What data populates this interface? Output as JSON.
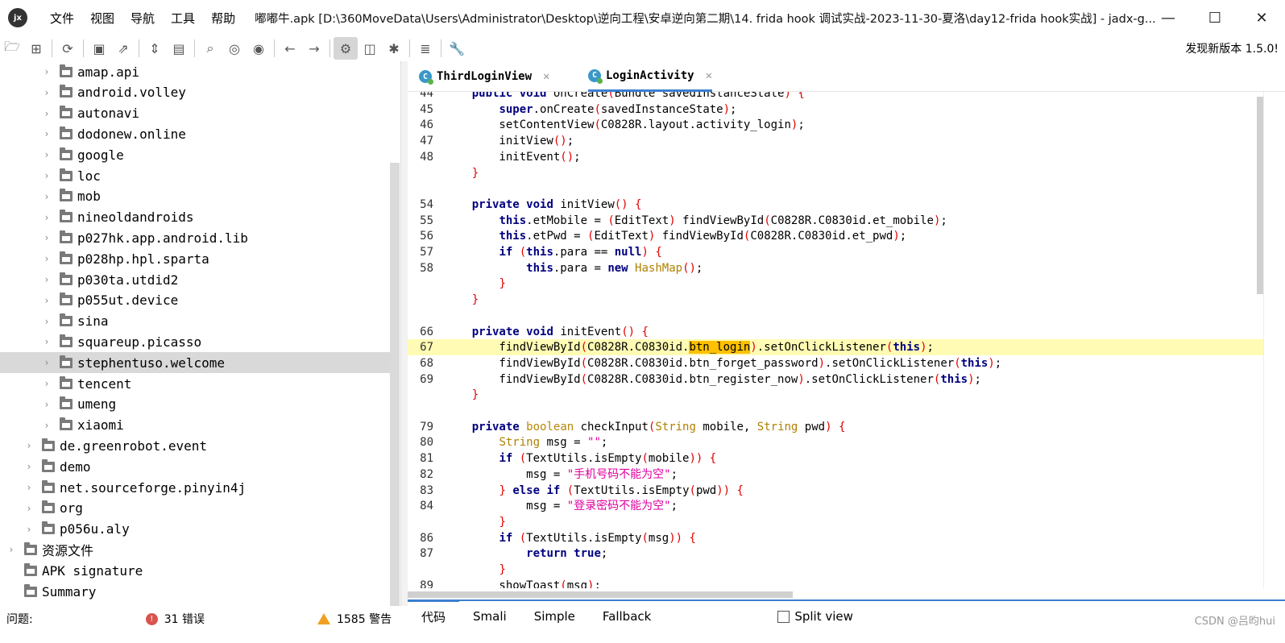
{
  "window": {
    "app_logo": "jadx-logo-icon",
    "title": "嘟嘟牛.apk [D:\\360MoveData\\Users\\Administrator\\Desktop\\逆向工程\\安卓逆向第二期\\14. frida hook 调试实战-2023-11-30-夏洛\\day12-frida hook实战] - jadx-g...",
    "menu": [
      "文件",
      "视图",
      "导航",
      "工具",
      "帮助"
    ],
    "controls": [
      "—",
      "☐",
      "✕"
    ]
  },
  "toolbar": {
    "icons": [
      "open-folder-icon",
      "add-files-icon",
      "sync-icon",
      "save-icon",
      "export-icon",
      "unfold-icon",
      "package-icon",
      "search-icon",
      "find-class-icon",
      "find-usage-icon",
      "back-icon",
      "forward-icon",
      "deobfuscation-icon",
      "decompile-icon",
      "debug-icon",
      "log-icon",
      "settings-icon"
    ],
    "new_version": "发现新版本 1.5.0!"
  },
  "tree": {
    "items": [
      {
        "label": "amap.api",
        "level": 2
      },
      {
        "label": "android.volley",
        "level": 2
      },
      {
        "label": "autonavi",
        "level": 2
      },
      {
        "label": "dodonew.online",
        "level": 2
      },
      {
        "label": "google",
        "level": 2
      },
      {
        "label": "loc",
        "level": 2
      },
      {
        "label": "mob",
        "level": 2
      },
      {
        "label": "nineoldandroids",
        "level": 2
      },
      {
        "label": "p027hk.app.android.lib",
        "level": 2
      },
      {
        "label": "p028hp.hpl.sparta",
        "level": 2
      },
      {
        "label": "p030ta.utdid2",
        "level": 2
      },
      {
        "label": "p055ut.device",
        "level": 2
      },
      {
        "label": "sina",
        "level": 2
      },
      {
        "label": "squareup.picasso",
        "level": 2
      },
      {
        "label": "stephentuso.welcome",
        "level": 2,
        "selected": true
      },
      {
        "label": "tencent",
        "level": 2
      },
      {
        "label": "umeng",
        "level": 2
      },
      {
        "label": "xiaomi",
        "level": 2
      },
      {
        "label": "de.greenrobot.event",
        "level": 1
      },
      {
        "label": "demo",
        "level": 1
      },
      {
        "label": "net.sourceforge.pinyin4j",
        "level": 1
      },
      {
        "label": "org",
        "level": 1
      },
      {
        "label": "p056u.aly",
        "level": 1
      },
      {
        "label": "资源文件",
        "level": 0
      },
      {
        "label": "APK signature",
        "level": 0
      },
      {
        "label": "Summary",
        "level": 0
      }
    ]
  },
  "tabs": [
    {
      "label": "ThirdLoginView",
      "active": false
    },
    {
      "label": "LoginActivity",
      "active": true
    }
  ],
  "code": {
    "lines": [
      {
        "num": "44",
        "html": "    <span class=k>public</span> <span class=k>void</span> onCreate<span class=p>(</span>Bundle savedInstanceState<span class=p>)</span> <span class=p>{</span>"
      },
      {
        "num": "45",
        "html": "        <span class=k>super</span>.onCreate<span class=p>(</span>savedInstanceState<span class=p>)</span>;"
      },
      {
        "num": "46",
        "html": "        setContentView<span class=p>(</span>C0828R.layout.activity_login<span class=p>)</span>;"
      },
      {
        "num": "47",
        "html": "        initView<span class=p>()</span>;"
      },
      {
        "num": "48",
        "html": "        initEvent<span class=p>()</span>;"
      },
      {
        "num": "",
        "html": "    <span class=p>}</span>"
      },
      {
        "num": "",
        "html": ""
      },
      {
        "num": "54",
        "html": "    <span class=k>private</span> <span class=k>void</span> initView<span class=p>()</span> <span class=p>{</span>"
      },
      {
        "num": "55",
        "html": "        <span class=k>this</span>.etMobile = <span class=p>(</span>EditText<span class=p>)</span> findViewById<span class=p>(</span>C0828R.C0830id.et_mobile<span class=p>)</span>;"
      },
      {
        "num": "56",
        "html": "        <span class=k>this</span>.etPwd = <span class=p>(</span>EditText<span class=p>)</span> findViewById<span class=p>(</span>C0828R.C0830id.et_pwd<span class=p>)</span>;"
      },
      {
        "num": "57",
        "html": "        <span class=k>if</span> <span class=p>(</span><span class=k>this</span>.para == <span class=k>null</span><span class=p>)</span> <span class=p>{</span>"
      },
      {
        "num": "58",
        "html": "            <span class=k>this</span>.para = <span class=k>new</span> <span class=ty>HashMap</span><span class=p>()</span>;"
      },
      {
        "num": "",
        "html": "        <span class=p>}</span>"
      },
      {
        "num": "",
        "html": "    <span class=p>}</span>"
      },
      {
        "num": "",
        "html": ""
      },
      {
        "num": "66",
        "html": "    <span class=k>private</span> <span class=k>void</span> initEvent<span class=p>()</span> <span class=p>{</span>"
      },
      {
        "num": "67",
        "html": "        findViewById<span class=p>(</span>C0828R.C0830id.<span class=sel>btn_login</span><span class=p>)</span>.setOnClickListener<span class=p>(</span><span class=k>this</span><span class=p>)</span>;",
        "highlight": true
      },
      {
        "num": "68",
        "html": "        findViewById<span class=p>(</span>C0828R.C0830id.btn_forget_password<span class=p>)</span>.setOnClickListener<span class=p>(</span><span class=k>this</span><span class=p>)</span>;"
      },
      {
        "num": "69",
        "html": "        findViewById<span class=p>(</span>C0828R.C0830id.btn_register_now<span class=p>)</span>.setOnClickListener<span class=p>(</span><span class=k>this</span><span class=p>)</span>;"
      },
      {
        "num": "",
        "html": "    <span class=p>}</span>"
      },
      {
        "num": "",
        "html": ""
      },
      {
        "num": "79",
        "html": "    <span class=k>private</span> <span class=t>boolean</span> checkInput<span class=p>(</span><span class=ty>String</span> mobile, <span class=ty>String</span> pwd<span class=p>)</span> <span class=p>{</span>"
      },
      {
        "num": "80",
        "html": "        <span class=ty>String</span> msg = <span class=s>\"\"</span>;"
      },
      {
        "num": "81",
        "html": "        <span class=k>if</span> <span class=p>(</span>TextUtils.isEmpty<span class=p>(</span>mobile<span class=p>))</span> <span class=p>{</span>"
      },
      {
        "num": "82",
        "html": "            msg = <span class=s>\"手机号码不能为空\"</span>;"
      },
      {
        "num": "83",
        "html": "        <span class=p>}</span> <span class=k>else</span> <span class=k>if</span> <span class=p>(</span>TextUtils.isEmpty<span class=p>(</span>pwd<span class=p>))</span> <span class=p>{</span>"
      },
      {
        "num": "84",
        "html": "            msg = <span class=s>\"登录密码不能为空\"</span>;"
      },
      {
        "num": "",
        "html": "        <span class=p>}</span>"
      },
      {
        "num": "86",
        "html": "        <span class=k>if</span> <span class=p>(</span>TextUtils.isEmpty<span class=p>(</span>msg<span class=p>))</span> <span class=p>{</span>"
      },
      {
        "num": "87",
        "html": "            <span class=k>return</span> <span class=k>true</span>;"
      },
      {
        "num": "",
        "html": "        <span class=p>}</span>"
      },
      {
        "num": "89",
        "html": "        showToast<span class=p>(</span>msg<span class=p>)</span>;"
      }
    ]
  },
  "view_tabs": [
    "代码",
    "Smali",
    "Simple",
    "Fallback"
  ],
  "split_view_label": "Split view",
  "status": {
    "problems_label": "问题:",
    "errors": "31 错误",
    "warnings": "1585 警告"
  },
  "watermark": "CSDN @吕昀hui"
}
